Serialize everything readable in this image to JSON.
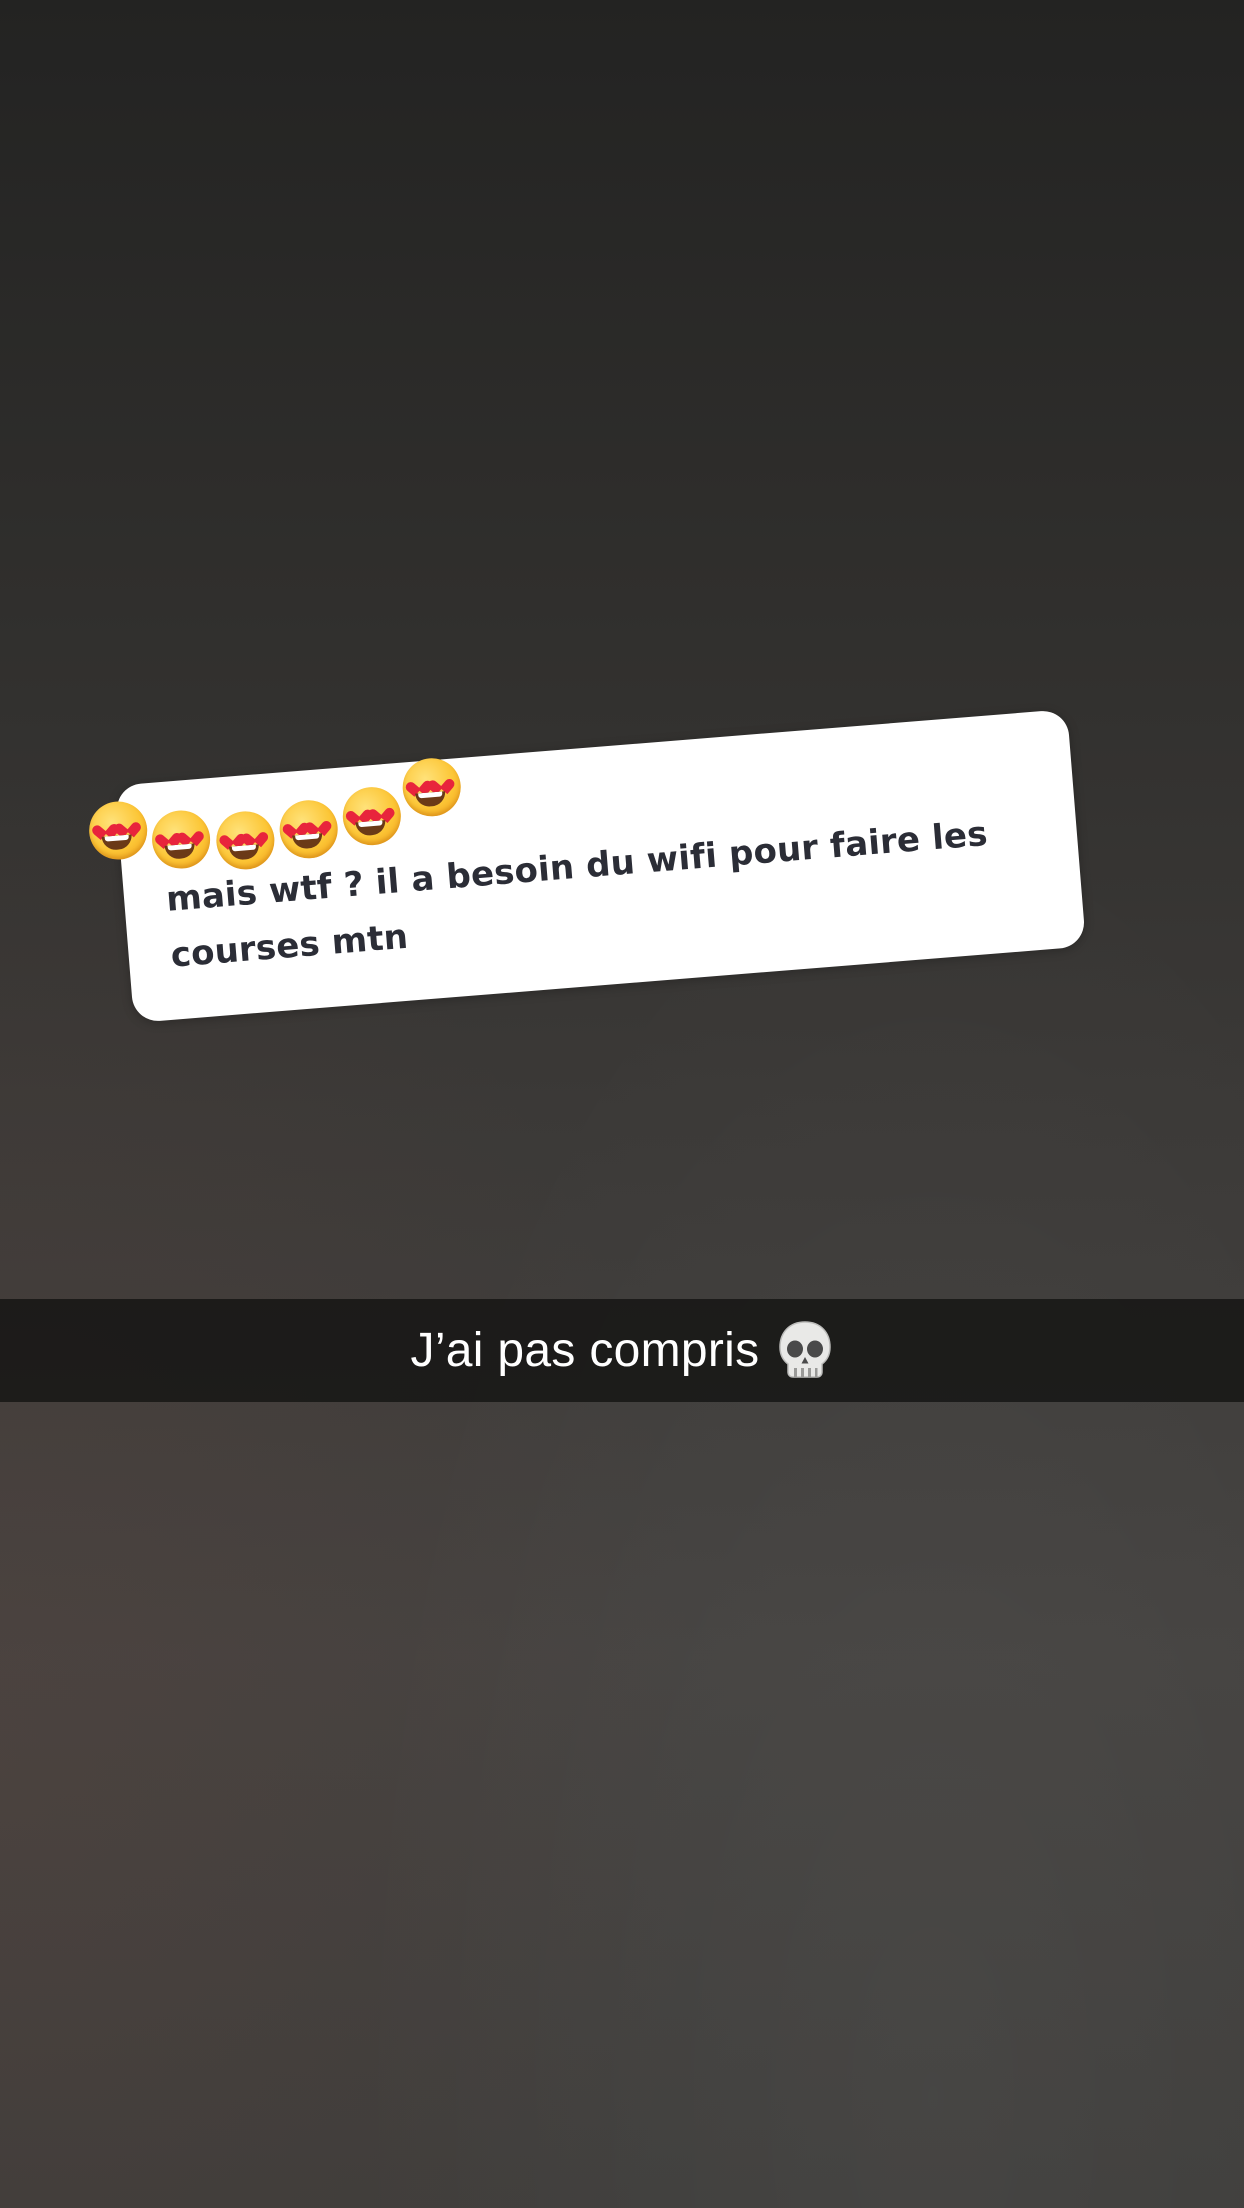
{
  "reply_sticker": {
    "message": "mais wtf ? il a besoin du wifi pour faire les courses mtn",
    "reactions": [
      "heart-eyes-icon",
      "heart-eyes-icon",
      "heart-eyes-icon",
      "heart-eyes-icon",
      "heart-eyes-icon",
      "heart-eyes-icon"
    ]
  },
  "caption": {
    "text": "J’ai pas compris",
    "icon": "skull-icon"
  },
  "colors": {
    "card_background": "#ffffff",
    "card_text": "#2b2d36",
    "caption_bar": "#121211",
    "caption_text": "#ffffff",
    "background_top": "#232322",
    "background_bottom": "#444240"
  }
}
